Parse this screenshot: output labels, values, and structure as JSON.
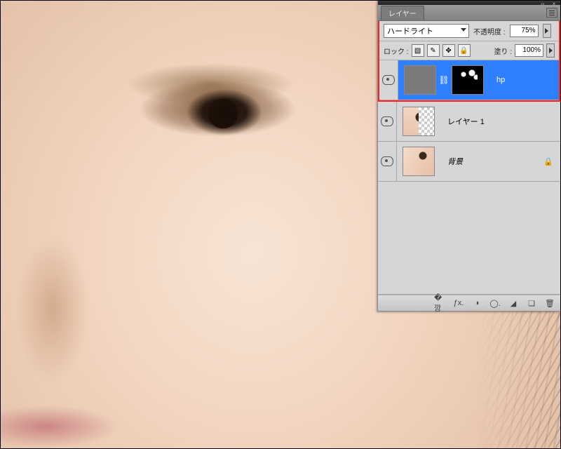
{
  "panel": {
    "tab_title": "レイヤー",
    "blend_mode": "ハードライト",
    "opacity_label": "不透明度 :",
    "opacity_value": "75%",
    "lock_label": "ロック :",
    "fill_label": "塗り :",
    "fill_value": "100%",
    "layers": [
      {
        "name": "hp",
        "selected": true,
        "has_mask": true,
        "thumb": "gray",
        "mask": "mask",
        "locked": false,
        "italic": false
      },
      {
        "name": "レイヤー 1",
        "selected": false,
        "has_mask": false,
        "thumb": "face trans",
        "locked": false,
        "italic": false
      },
      {
        "name": "背景",
        "selected": false,
        "has_mask": false,
        "thumb": "face2",
        "locked": true,
        "italic": true
      }
    ],
    "lock_icons": [
      "▧",
      "✎",
      "✥",
      "🔒"
    ],
    "footer_icons": [
      "�깜",
      "ƒx.",
      "◑",
      "◯.",
      "◢",
      "❏",
      "🗑"
    ]
  }
}
